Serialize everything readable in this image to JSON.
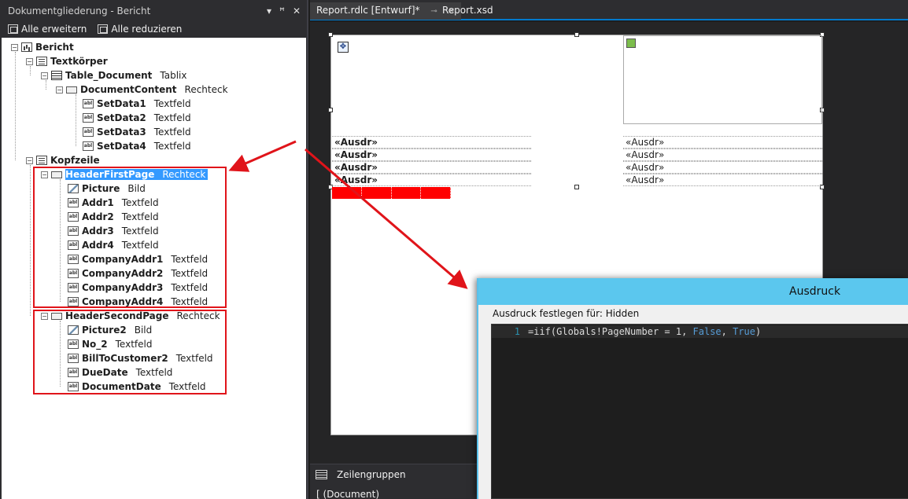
{
  "outline_panel": {
    "title": "Dokumentgliederung - Bericht",
    "controls": {
      "dropdown": "▾",
      "pin": "ꟸ",
      "close": "✕"
    },
    "toolbar": {
      "expand_all": "Alle erweitern",
      "collapse_all": "Alle reduzieren"
    },
    "tree": [
      {
        "name": "Bericht",
        "type": ""
      },
      {
        "name": "Textkörper",
        "type": ""
      },
      {
        "name": "Table_Document",
        "type": "Tablix"
      },
      {
        "name": "DocumentContent",
        "type": "Rechteck"
      },
      {
        "name": "SetData1",
        "type": "Textfeld"
      },
      {
        "name": "SetData2",
        "type": "Textfeld"
      },
      {
        "name": "SetData3",
        "type": "Textfeld"
      },
      {
        "name": "SetData4",
        "type": "Textfeld"
      },
      {
        "name": "Kopfzeile",
        "type": ""
      },
      {
        "name": "HeaderFirstPage",
        "type": "Rechteck"
      },
      {
        "name": "Picture",
        "type": "Bild"
      },
      {
        "name": "Addr1",
        "type": "Textfeld"
      },
      {
        "name": "Addr2",
        "type": "Textfeld"
      },
      {
        "name": "Addr3",
        "type": "Textfeld"
      },
      {
        "name": "Addr4",
        "type": "Textfeld"
      },
      {
        "name": "CompanyAddr1",
        "type": "Textfeld"
      },
      {
        "name": "CompanyAddr2",
        "type": "Textfeld"
      },
      {
        "name": "CompanyAddr3",
        "type": "Textfeld"
      },
      {
        "name": "CompanyAddr4",
        "type": "Textfeld"
      },
      {
        "name": "HeaderSecondPage",
        "type": "Rechteck"
      },
      {
        "name": "Picture2",
        "type": "Bild"
      },
      {
        "name": "No_2",
        "type": "Textfeld"
      },
      {
        "name": "BillToCustomer2",
        "type": "Textfeld"
      },
      {
        "name": "DueDate",
        "type": "Textfeld"
      },
      {
        "name": "DocumentDate",
        "type": "Textfeld"
      }
    ],
    "selected_item": "HeaderFirstPage"
  },
  "tabs": [
    {
      "label": "Report.rdlc [Entwurf]*",
      "active": true,
      "pin": "⊸",
      "close": "✕"
    },
    {
      "label": "Report.xsd",
      "active": false
    }
  ],
  "design_surface": {
    "placeholder": "«Ausdr»",
    "left_fields": [
      "«Ausdr»",
      "«Ausdr»",
      "«Ausdr»",
      "«Ausdr»"
    ],
    "right_fields": [
      "«Ausdr»",
      "«Ausdr»",
      "«Ausdr»",
      "«Ausdr»"
    ]
  },
  "row_groups": {
    "title": "Zeilengruppen",
    "item": "(Document)",
    "bracket": "["
  },
  "expression_dialog": {
    "title": "Ausdruck",
    "label": "Ausdruck festlegen für: Hidden",
    "line_number": "1",
    "code_prefix": "=iif(Globals!PageNumber = 1, ",
    "code_kw1": "False",
    "code_sep": ", ",
    "code_kw2": "True",
    "code_suffix": ")"
  },
  "colors": {
    "highlight_box": "#e0141a",
    "selection": "#3399ff",
    "dialog_titlebar": "#5bc7ee",
    "code_keyword": "#569cd6"
  }
}
